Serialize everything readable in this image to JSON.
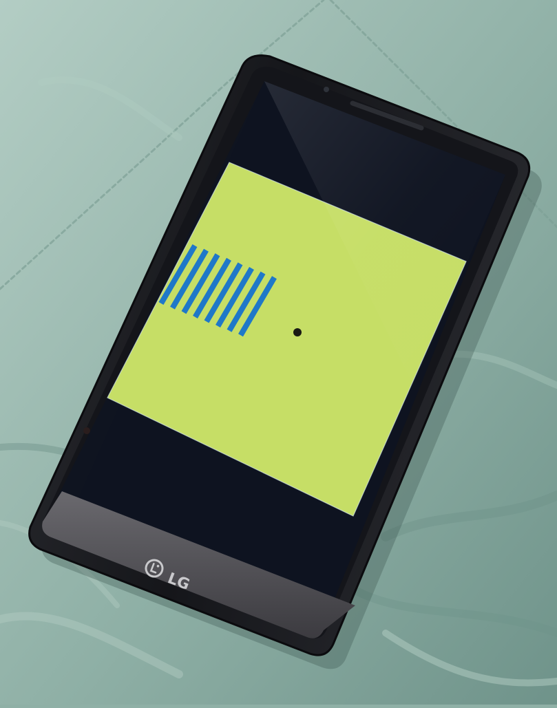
{
  "scene": {
    "background_color": "#8fb0a6",
    "fabric_shadow_color": "#6f938a",
    "fabric_highlight_color": "#b3cdc4"
  },
  "phone": {
    "body_color": "#1b1c20",
    "bezel_color": "#2a2b30",
    "screen_off_color": "#0f1420",
    "chin_color": "#5b5a5f",
    "brand": {
      "logo_icon": "lg-logo-icon",
      "text": "LG",
      "color": "#c9c9cc"
    }
  },
  "display": {
    "background_color": "#c6de66",
    "stimulus": {
      "type": "grating",
      "stripe_count": 8,
      "stripe_color": "#1f78c8"
    },
    "fixation_dot": {
      "color": "#1a1a14"
    }
  }
}
